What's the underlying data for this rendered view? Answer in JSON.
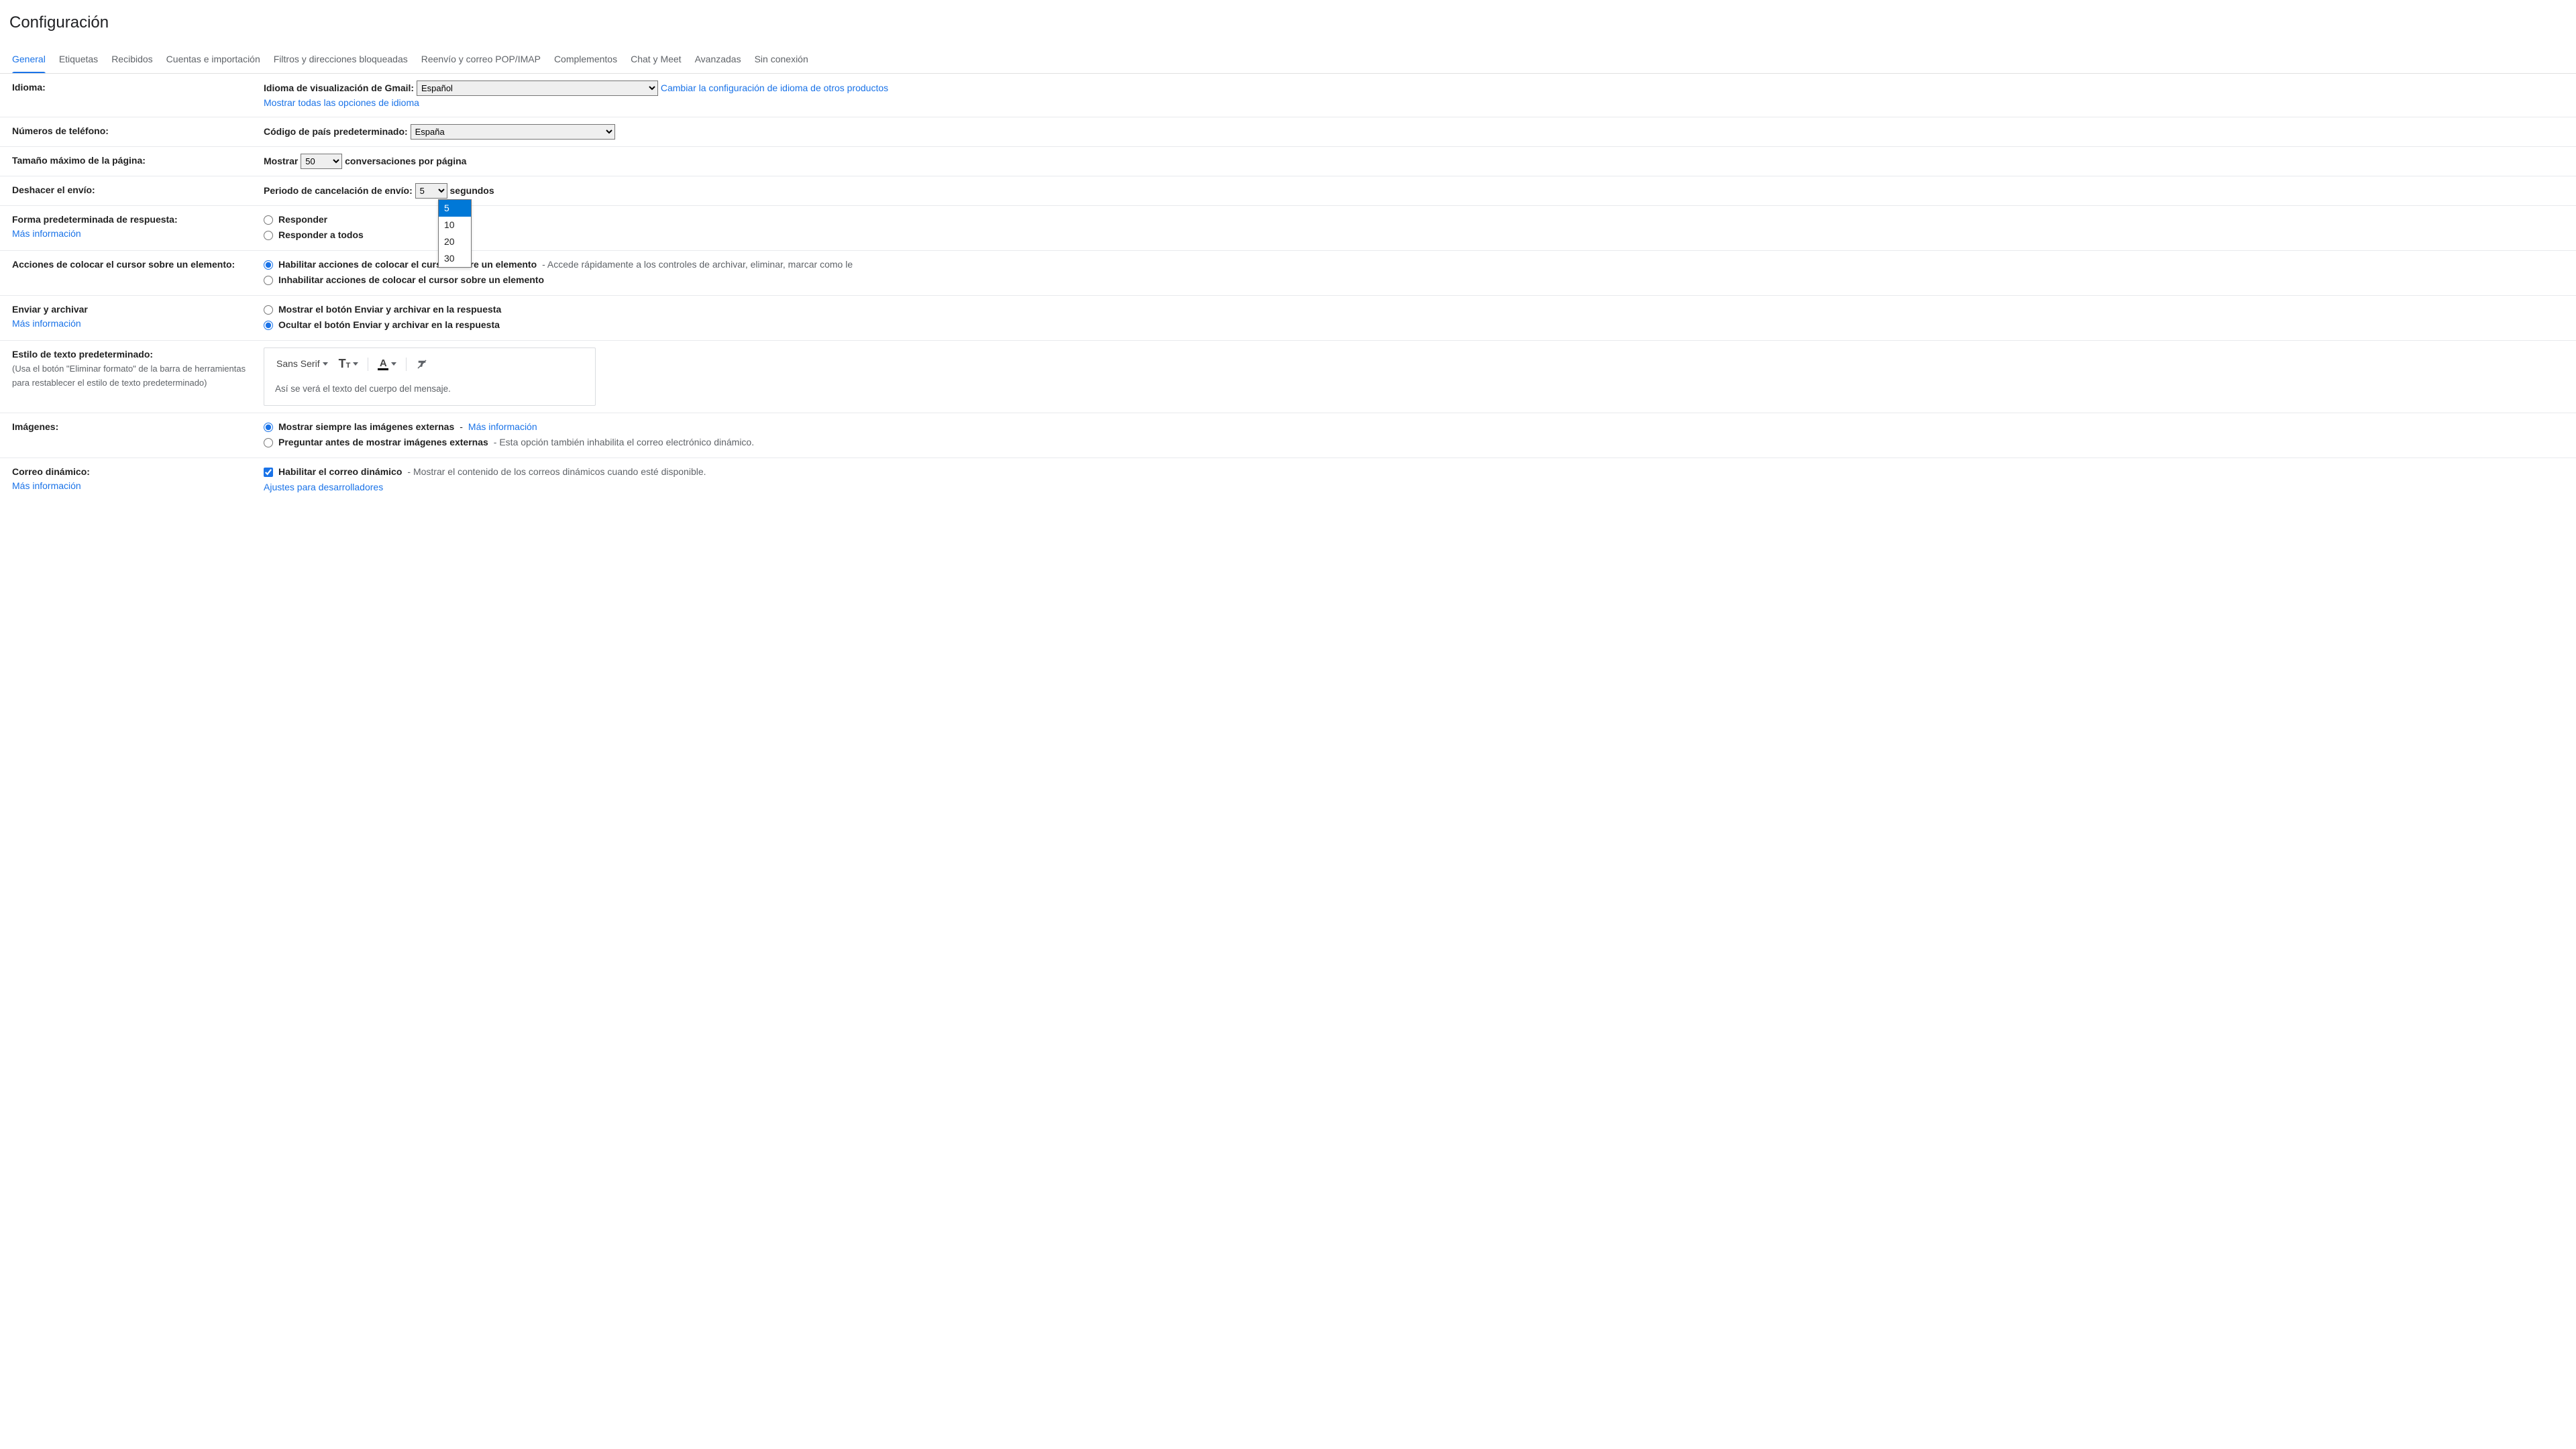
{
  "page_title": "Configuración",
  "tabs": [
    "General",
    "Etiquetas",
    "Recibidos",
    "Cuentas e importación",
    "Filtros y direcciones bloqueadas",
    "Reenvío y correo POP/IMAP",
    "Complementos",
    "Chat y Meet",
    "Avanzadas",
    "Sin conexión"
  ],
  "language": {
    "label": "Idioma:",
    "display_label": "Idioma de visualización de Gmail:",
    "select_value": "Español",
    "change_other_link": "Cambiar la configuración de idioma de otros productos",
    "show_all_link": "Mostrar todas las opciones de idioma"
  },
  "phone": {
    "label": "Números de teléfono:",
    "code_label": "Código de país predeterminado:",
    "select_value": "España"
  },
  "page_size": {
    "label": "Tamaño máximo de la página:",
    "show_word": "Mostrar",
    "select_value": "50",
    "suffix": "conversaciones por página"
  },
  "undo_send": {
    "label": "Deshacer el envío:",
    "period_label": "Periodo de cancelación de envío:",
    "select_value": "5",
    "suffix": "segundos",
    "options": [
      "5",
      "10",
      "20",
      "30"
    ]
  },
  "reply_default": {
    "label": "Forma predeterminada de respuesta:",
    "learn_more": "Más información",
    "opt_reply": "Responder",
    "opt_reply_all": "Responder a todos"
  },
  "hover": {
    "label": "Acciones de colocar el cursor sobre un elemento:",
    "enable": "Habilitar acciones de colocar el cursor sobre un elemento",
    "enable_desc": " - Accede rápidamente a los controles de archivar, eliminar, marcar como le",
    "disable": "Inhabilitar acciones de colocar el cursor sobre un elemento"
  },
  "send_archive": {
    "label": "Enviar y archivar",
    "learn_more": "Más información",
    "show": "Mostrar el botón Enviar y archivar en la respuesta",
    "hide": "Ocultar el botón Enviar y archivar en la respuesta"
  },
  "text_style": {
    "label": "Estilo de texto predeterminado:",
    "sub": "(Usa el botón \"Eliminar formato\" de la barra de herramientas para restablecer el estilo de texto predeterminado)",
    "font_name": "Sans Serif",
    "preview": "Así se verá el texto del cuerpo del mensaje."
  },
  "images": {
    "label": "Imágenes:",
    "always": "Mostrar siempre las imágenes externas",
    "learn_more": "Más información",
    "ask": "Preguntar antes de mostrar imágenes externas",
    "ask_desc": " - Esta opción también inhabilita el correo electrónico dinámico."
  },
  "dynamic": {
    "label": "Correo dinámico:",
    "learn_more": "Más información",
    "enable": "Habilitar el correo dinámico",
    "enable_desc": " - Mostrar el contenido de los correos dinámicos cuando esté disponible.",
    "dev_link": "Ajustes para desarrolladores"
  }
}
